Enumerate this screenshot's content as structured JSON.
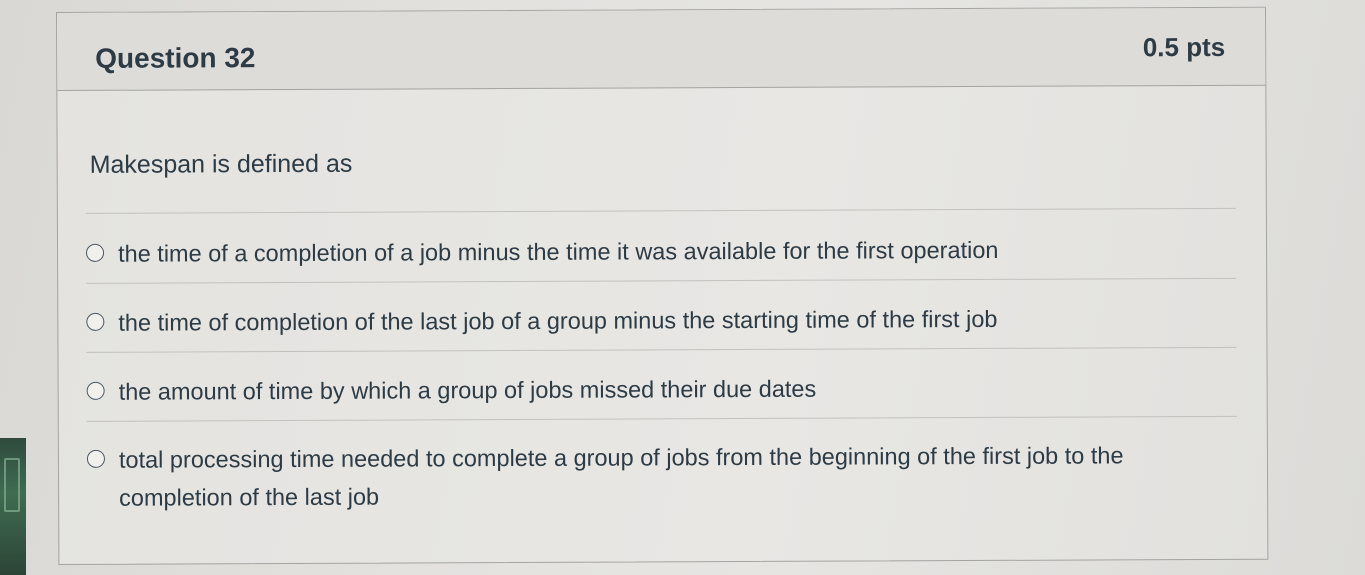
{
  "question": {
    "title": "Question 32",
    "points": "0.5 pts",
    "text": "Makespan is defined as"
  },
  "answers": [
    {
      "label": "the time of a completion of a job minus the time it was available for the first operation",
      "selected": false
    },
    {
      "label": "the time of completion of the last job of a group minus the starting time of the first job",
      "selected": false
    },
    {
      "label": "the amount of time by which a group of jobs missed their due dates",
      "selected": false
    },
    {
      "label": "total processing time needed to complete a group of jobs from the beginning of the first job to the completion of the last job",
      "selected": false
    }
  ],
  "colors": {
    "text": "#2d3b45",
    "border": "#a4a4a2",
    "header_bg": "#dddcd9"
  }
}
